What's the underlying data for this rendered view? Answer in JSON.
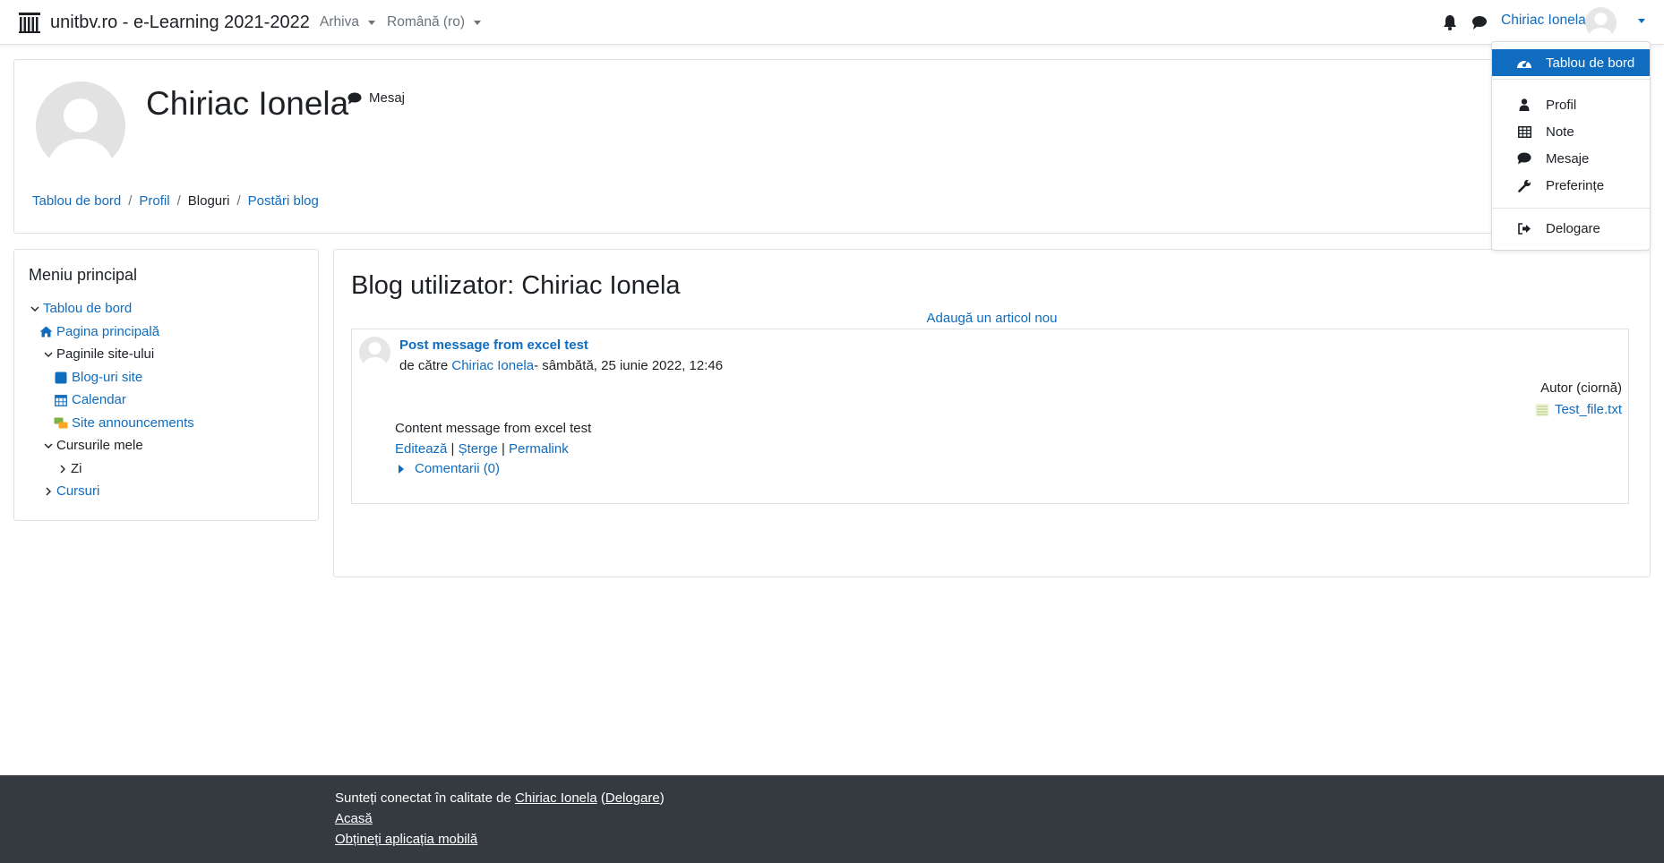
{
  "navbar": {
    "brand": "unitbv.ro - e-Learning 2021-2022",
    "menu_archive": "Arhiva",
    "menu_language": "Română (ro)",
    "user_name": "Chiriac Ionela"
  },
  "user_menu": {
    "items": [
      {
        "label": "Tablou de bord",
        "icon": "dashboard-icon"
      },
      {
        "label": "Profil",
        "icon": "user-icon"
      },
      {
        "label": "Note",
        "icon": "table-icon"
      },
      {
        "label": "Mesaje",
        "icon": "chat-icon"
      },
      {
        "label": "Preferințe",
        "icon": "wrench-icon"
      },
      {
        "label": "Delogare",
        "icon": "logout-icon"
      }
    ]
  },
  "header": {
    "name": "Chiriac Ionela",
    "message_label": "Mesaj",
    "breadcrumb": [
      "Tablou de bord",
      "Profil",
      "Bloguri",
      "Postări blog"
    ]
  },
  "sidebar": {
    "title": "Meniu principal",
    "items": [
      "Tablou de bord",
      "Pagina principală",
      "Paginile site-ului",
      "Blog-uri site",
      "Calendar",
      "Site announcements",
      "Cursurile mele",
      "Zi",
      "Cursuri"
    ]
  },
  "main": {
    "title": "Blog utilizator: Chiriac Ionela",
    "add_entry": "Adaugă un articol nou",
    "post": {
      "title": "Post message from excel test",
      "by_prefix": "de către ",
      "author": "Chiriac Ionela",
      "date": "- sâmbătă, 25 iunie 2022, 12:46",
      "publish_state": "Autor (ciornă)",
      "attachment": "Test_file.txt",
      "content": "Content message from excel test",
      "edit": "Editează",
      "delete": "Șterge",
      "permalink": "Permalink",
      "separator": " | ",
      "comments": "Comentarii (0)"
    }
  },
  "footer": {
    "logged_prefix": "Sunteți conectat în calitate de ",
    "logged_user": "Chiriac Ionela",
    "logout_open": " (",
    "logout": "Delogare",
    "logout_close": ")",
    "home": "Acasă",
    "mobile": "Obțineți aplicația mobilă"
  },
  "colors": {
    "link": "#0f6cbf",
    "footer_bg": "#343a40",
    "active_item": "#0f6cbf"
  }
}
